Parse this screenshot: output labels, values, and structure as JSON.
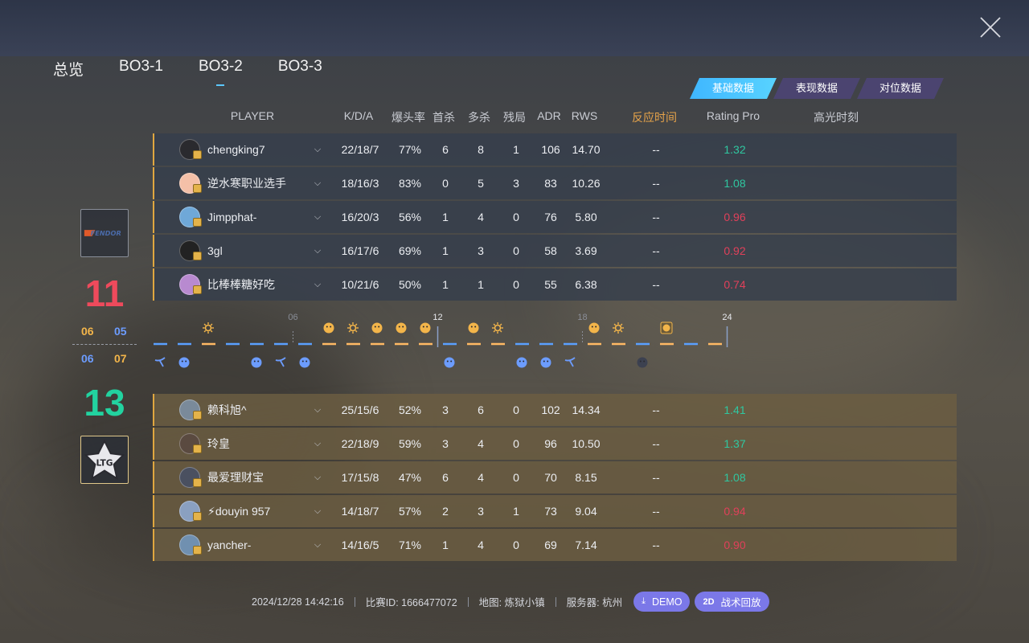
{
  "tabs": [
    {
      "label": "总览"
    },
    {
      "label": "BO3-1"
    },
    {
      "label": "BO3-2",
      "active": true
    },
    {
      "label": "BO3-3"
    }
  ],
  "data_tabs": [
    {
      "label": "基础数据",
      "active": true
    },
    {
      "label": "表现数据"
    },
    {
      "label": "对位数据"
    }
  ],
  "columns": {
    "player": "PLAYER",
    "kda": "K/D/A",
    "hs": "爆头率",
    "first_kill": "首杀",
    "multi_kill": "多杀",
    "clutch": "残局",
    "adr": "ADR",
    "rws": "RWS",
    "reaction": "反应时间",
    "rating": "Rating Pro",
    "highlight": "高光时刻"
  },
  "team_top": {
    "score": "11",
    "half1": "06",
    "half2": "06",
    "logo_text": "FENDOR",
    "players": [
      {
        "name": "chengking7",
        "kda": "22/18/7",
        "hs": "77%",
        "first_kill": "6",
        "multi_kill": "8",
        "clutch": "1",
        "adr": "106",
        "rws": "14.70",
        "reaction": "--",
        "rating": "1.32",
        "good": true,
        "avatar_color": "#2a2a2e"
      },
      {
        "name": "逆水寒职业选手",
        "kda": "18/16/3",
        "hs": "83%",
        "first_kill": "0",
        "multi_kill": "5",
        "clutch": "3",
        "adr": "83",
        "rws": "10.26",
        "reaction": "--",
        "rating": "1.08",
        "good": true,
        "avatar_color": "#f4c0a8"
      },
      {
        "name": "Jimpphat-",
        "kda": "16/20/3",
        "hs": "56%",
        "first_kill": "1",
        "multi_kill": "4",
        "clutch": "0",
        "adr": "76",
        "rws": "5.80",
        "reaction": "--",
        "rating": "0.96",
        "good": false,
        "avatar_color": "#6fa8d8"
      },
      {
        "name": "3gl",
        "kda": "16/17/6",
        "hs": "69%",
        "first_kill": "1",
        "multi_kill": "3",
        "clutch": "0",
        "adr": "58",
        "rws": "3.69",
        "reaction": "--",
        "rating": "0.92",
        "good": false,
        "avatar_color": "#222"
      },
      {
        "name": "比棒棒糖好吃",
        "kda": "10/21/6",
        "hs": "50%",
        "first_kill": "1",
        "multi_kill": "1",
        "clutch": "0",
        "adr": "55",
        "rws": "6.38",
        "reaction": "--",
        "rating": "0.74",
        "good": false,
        "avatar_color": "#b88ad0"
      }
    ]
  },
  "team_bottom": {
    "score": "13",
    "half1": "05",
    "half2": "07",
    "logo_text": "LTG",
    "players": [
      {
        "name": "赖科旭^",
        "kda": "25/15/6",
        "hs": "52%",
        "first_kill": "3",
        "multi_kill": "6",
        "clutch": "0",
        "adr": "102",
        "rws": "14.34",
        "reaction": "--",
        "rating": "1.41",
        "good": true,
        "avatar_color": "#7a8a9a"
      },
      {
        "name": "玲皇",
        "kda": "22/18/9",
        "hs": "59%",
        "first_kill": "3",
        "multi_kill": "4",
        "clutch": "0",
        "adr": "96",
        "rws": "10.50",
        "reaction": "--",
        "rating": "1.37",
        "good": true,
        "avatar_color": "#5a4a40"
      },
      {
        "name": "最爱理财宝",
        "kda": "17/15/8",
        "hs": "47%",
        "first_kill": "6",
        "multi_kill": "4",
        "clutch": "0",
        "adr": "70",
        "rws": "8.15",
        "reaction": "--",
        "rating": "1.08",
        "good": true,
        "avatar_color": "#4a5060"
      },
      {
        "name": "⚡douyin 957",
        "kda": "14/18/7",
        "hs": "57%",
        "first_kill": "2",
        "multi_kill": "3",
        "clutch": "1",
        "adr": "73",
        "rws": "9.04",
        "reaction": "--",
        "rating": "0.94",
        "good": false,
        "avatar_color": "#8aa0c0"
      },
      {
        "name": "yancher-",
        "kda": "14/16/5",
        "hs": "71%",
        "first_kill": "1",
        "multi_kill": "4",
        "clutch": "0",
        "adr": "69",
        "rws": "7.14",
        "reaction": "--",
        "rating": "0.90",
        "good": false,
        "avatar_color": "#7090b0"
      }
    ]
  },
  "timeline": {
    "markers": [
      "06",
      "12",
      "18",
      "24"
    ],
    "rounds": [
      {
        "winner": "bottom",
        "icon": "defuse"
      },
      {
        "winner": "bottom",
        "icon": "elim"
      },
      {
        "winner": "top",
        "icon": "bomb"
      },
      {
        "winner": "bottom",
        "icon": "none"
      },
      {
        "winner": "bottom",
        "icon": "elim"
      },
      {
        "winner": "bottom",
        "icon": "defuse"
      },
      {
        "winner": "bottom",
        "icon": "elim"
      },
      {
        "winner": "top",
        "icon": "elim"
      },
      {
        "winner": "top",
        "icon": "bomb"
      },
      {
        "winner": "top",
        "icon": "elim"
      },
      {
        "winner": "top",
        "icon": "elim"
      },
      {
        "winner": "top",
        "icon": "elim"
      },
      {
        "winner": "bottom",
        "icon": "elim"
      },
      {
        "winner": "top",
        "icon": "elim"
      },
      {
        "winner": "top",
        "icon": "bomb"
      },
      {
        "winner": "bottom",
        "icon": "elim"
      },
      {
        "winner": "bottom",
        "icon": "elim"
      },
      {
        "winner": "bottom",
        "icon": "defuse"
      },
      {
        "winner": "top",
        "icon": "elim"
      },
      {
        "winner": "top",
        "icon": "bomb"
      },
      {
        "winner": "bottom",
        "icon": "elim-dark"
      },
      {
        "winner": "top",
        "icon": "time"
      },
      {
        "winner": "bottom",
        "icon": "none"
      },
      {
        "winner": "top",
        "icon": "none"
      }
    ],
    "colors": {
      "top": "#ffb964",
      "bottom": "#5aa0ff",
      "top_icon": "#f3b54a",
      "bottom_icon": "#6c9cff"
    }
  },
  "footer": {
    "datetime": "2024/12/28 14:42:16",
    "match_id": "比赛ID: 1666477072",
    "map": "地图: 炼狱小镇",
    "server": "服务器: 杭州",
    "demo_label": "DEMO",
    "replay_badge": "2D",
    "replay_label": "战术回放"
  }
}
